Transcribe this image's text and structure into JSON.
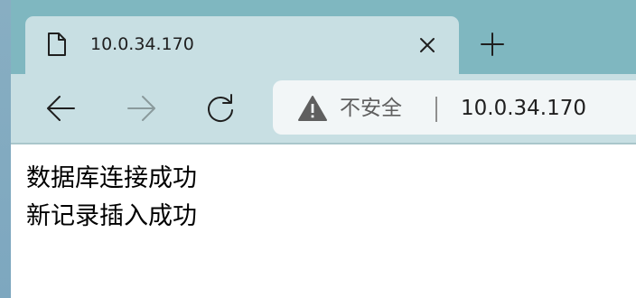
{
  "browser": {
    "tab": {
      "title": "10.0.34.170",
      "icon": "file-icon",
      "close_icon": "close-icon"
    },
    "new_tab_icon": "plus-icon",
    "toolbar": {
      "back_icon": "arrow-left-icon",
      "forward_icon": "arrow-right-icon",
      "reload_icon": "reload-icon"
    },
    "addressbar": {
      "security_icon": "warning-icon",
      "security_label": "不安全",
      "url": "10.0.34.170"
    },
    "colors": {
      "tabstrip": "#7fb7c0",
      "toolbar": "#c8dfe3",
      "addressbar": "#f2f6f7",
      "page": "#ffffff"
    }
  },
  "page": {
    "lines": [
      "数据库连接成功",
      "新记录插入成功"
    ]
  }
}
